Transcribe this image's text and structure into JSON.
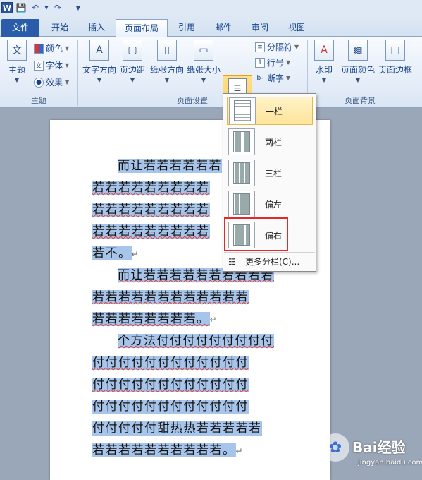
{
  "qat": {
    "word_icon": "W",
    "save_icon": "save-icon",
    "undo_icon": "undo-icon",
    "redo_icon": "redo-icon"
  },
  "tabs": [
    {
      "label": "文件"
    },
    {
      "label": "开始"
    },
    {
      "label": "插入"
    },
    {
      "label": "页面布局"
    },
    {
      "label": "引用"
    },
    {
      "label": "邮件"
    },
    {
      "label": "审阅"
    },
    {
      "label": "视图"
    }
  ],
  "ribbon": {
    "theme": {
      "label": "主题",
      "colors": "颜色",
      "fonts": "字体",
      "effects": "效果",
      "group": "主题"
    },
    "page_setup": {
      "text_direction": "文字方向",
      "margins": "页边距",
      "orientation": "纸张方向",
      "size": "纸张大小",
      "columns": "分栏",
      "breaks": "分隔符",
      "line_numbers": "行号",
      "hyphenation": "断字",
      "group": "页面设置"
    },
    "page_bg": {
      "watermark": "水印",
      "page_color": "页面颜色",
      "page_borders": "页面边框",
      "group": "页面背景"
    }
  },
  "columns_menu": {
    "items": [
      {
        "label": "一栏"
      },
      {
        "label": "两栏"
      },
      {
        "label": "三栏"
      },
      {
        "label": "偏左"
      },
      {
        "label": "偏右"
      }
    ],
    "more": "更多分栏(C)..."
  },
  "document": {
    "lines": [
      "而让若若若若若若",
      "若若若若若若若若若",
      "若若若若若若若若若",
      "若若若若若若若若若",
      "若不。",
      "而让若若若若若若若若若若",
      "若若若若若若若若若若若若",
      "若若若若若若若若。",
      "个方法付付付付付付付付付",
      "付付付付付付付付付付付付",
      "付付付付付付付付付付付付",
      "付付付付付付付付付付付付",
      "付付付付付甜热热若若若若若",
      "若若若若若若若若若若。"
    ]
  },
  "watermark": {
    "text": "Bai经验",
    "url": "jingyan.baidu.com"
  }
}
